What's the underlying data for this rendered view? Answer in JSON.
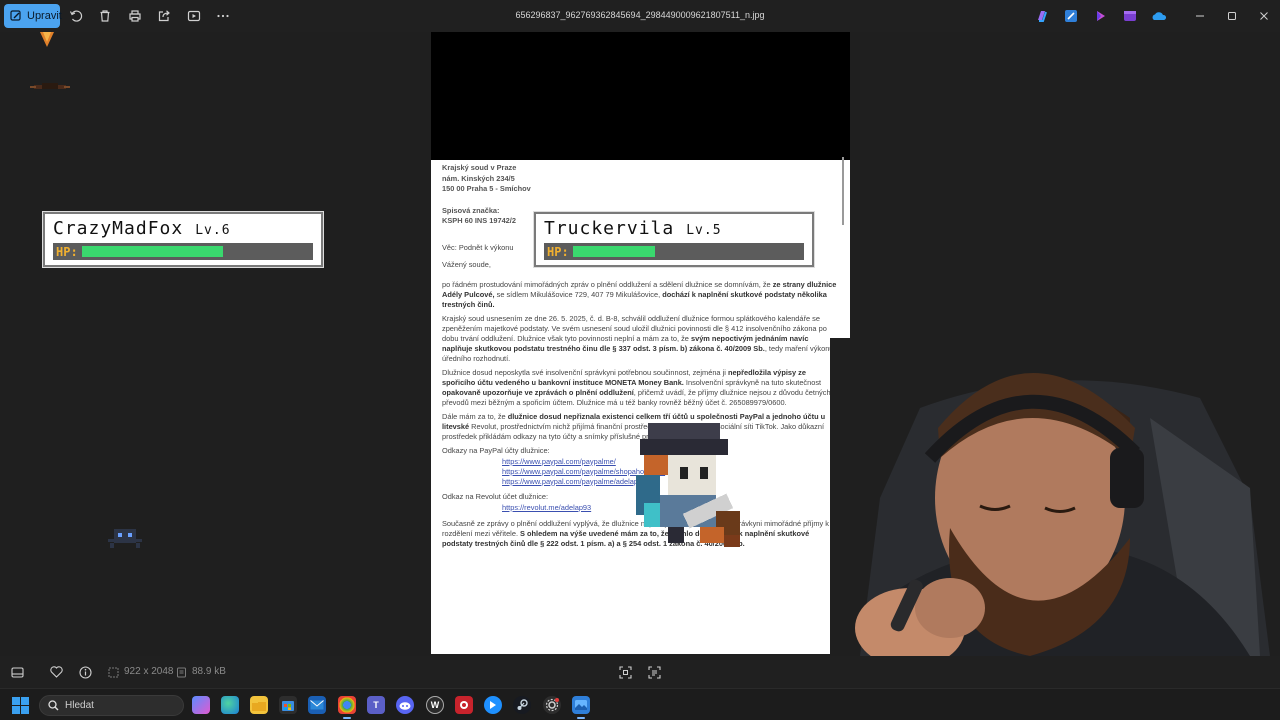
{
  "titlebar": {
    "edit_label": "Upravit",
    "filename": "656296837_962769362845694_2984490009621807511_n.jpg"
  },
  "document": {
    "court_address": [
      "Krajský soud v Praze",
      "nám. Kinských 234/5",
      "150 00 Praha 5 - Smíchov"
    ],
    "file_ref_label": "Spisová značka:",
    "file_ref_value": "KSPH 60 INS 19742/2",
    "subject": "Věc: Podnět k výkonu",
    "salutation": "Vážený soude,",
    "para1_a": "po řádném prostudování mimořádných zpráv o plnění oddlužení a sdělení dlužnice se domnívám, že ",
    "para1_b": "ze strany dlužnice Adély Pulcové,",
    "para1_c": " se sídlem Mikulášovice 729, 407 79 Mikulášovice, ",
    "para1_d": "dochází k naplnění skutkové podstaty několika trestných činů.",
    "para2_a": "Krajský soud usnesením ze dne 26. 5. 2025, č. d. B-8, schválil oddlužení dlužnice formou splátkového kalendáře se zpeněžením majetkové podstaty. Ve svém usnesení soud uložil dlužnici povinnosti dle § 412 insolvenčního zákona po dobu trvání oddlužení. Dlužnice však tyto povinnosti neplní a mám za to, že ",
    "para2_b": "svým nepoctivým jednáním navíc naplňuje skutkovou podstatu trestného činu dle § 337 odst. 3 písm. b) zákona č. 40/2009 Sb.",
    "para2_c": ", tedy maření výkonu úředního rozhodnutí.",
    "para3_a": "Dlužnice dosud neposkytla své insolvenční správkyni potřebnou součinnost, zejména ji ",
    "para3_b": "nepředložila výpisy ze spořicího účtu vedeného u bankovní instituce MONETA Money Bank.",
    "para3_c": " Insolvenční správkyně na tuto skutečnost ",
    "para3_d": "opakovaně upozorňuje ve zprávách o plnění oddlužení",
    "para3_e": ", přičemž uvádí, že příjmy dlužnice nejsou z důvodu četných převodů mezi běžným a spořicím účtem. Dlužnice má u též banky rovněž běžný účet č. 265089979/0600.",
    "para4_a": "Dále mám za to, že ",
    "para4_b": "dlužnice dosud nepřiznala existenci celkem tří účtů u společnosti PayPal a jednoho účtu u litevské",
    "para4_c": " Revolut, prostřednictvím nichž přijímá finanční prostředky (včetně darů) na sociální síti TikTok. Jako důkazní prostředek přikládám odkazy na tyto účty a snímky příslušné profily.",
    "paypal_heading": "Odkazy na PayPal účty dlužnice:",
    "paypal_links": [
      "https://www.paypal.com/paypalme/",
      "https://www.paypal.com/paypalme/shopaholicadel",
      "https://www.paypal.com/paypalme/adelapulcova"
    ],
    "revolut_heading": "Odkaz na Revolut účet dlužnice:",
    "revolut_link": "https://revolut.me/adelap93",
    "para5_a": "Současně ze zprávy o plnění oddlužení vyplývá, že dlužnice neposkytla své insolvenční správkyni mimořádné příjmy k rozdělení mezi věřitele. ",
    "para5_b": "S ohledem na výše uvedené mám za to, že mohlo dojít rovněž k naplnění skutkové podstaty trestných činů dle § 222 odst. 1 písm. a) a § 254 odst. 1 zákona č. 40/2009 Sb."
  },
  "overlays": {
    "player1": {
      "name": "CrazyMadFox",
      "level": "Lv.6",
      "hp_label": "HP:",
      "hp_fraction": 0.62
    },
    "player2": {
      "name": "Truckervila",
      "level": "Lv.5",
      "hp_label": "HP:",
      "hp_fraction": 0.36
    }
  },
  "bottombar": {
    "dimensions": "922 x 2048",
    "filesize": "88.9 kB"
  },
  "taskbar": {
    "search_placeholder": "Hledat"
  },
  "colors": {
    "accent": "#4ba3f0",
    "hp_fill": "#3ad86e",
    "hp_label": "#f0b030"
  }
}
